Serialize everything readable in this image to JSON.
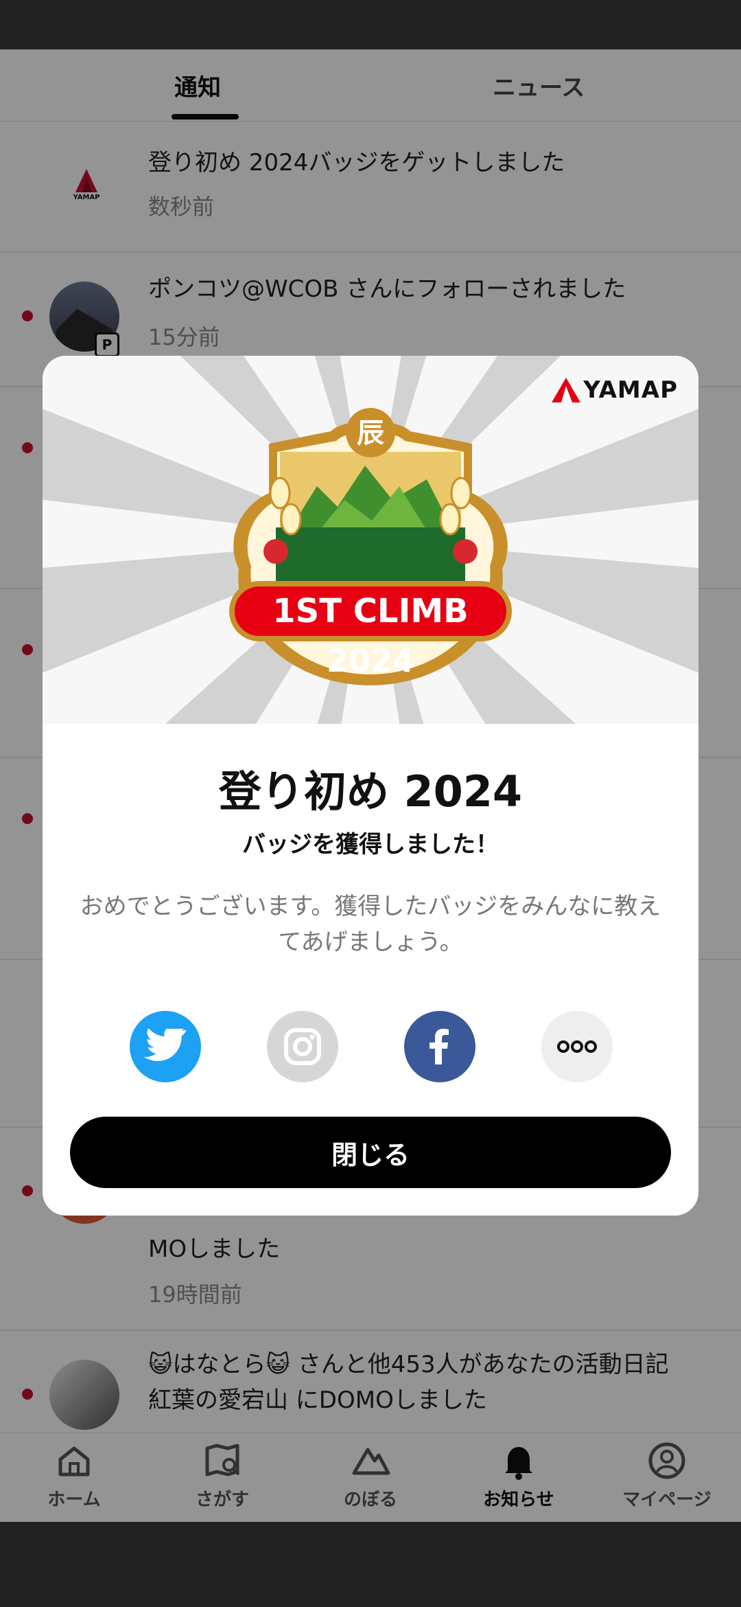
{
  "tabs": {
    "notifications": "通知",
    "news": "ニュース"
  },
  "notifications": [
    {
      "text": "登り初め 2024バッジをゲットしました",
      "time": "数秒前",
      "logo_text": "YAMAP"
    },
    {
      "text": "ポンコツ@WCOB さんにフォローされました",
      "time": "15分前",
      "badge": "P"
    },
    {
      "text_line2": "MOしました",
      "time": "19時間前"
    },
    {
      "text_line1": "😺はなとら😺 さんと他453人があなたの活動日記",
      "text_line2": "紅葉の愛宕山 にDOMOしました"
    }
  ],
  "modal": {
    "brand": "YAMAP",
    "badge_zodiac": "辰",
    "badge_title": "1ST CLIMB",
    "badge_year": "2024",
    "title": "登り初め 2024",
    "subtitle": "バッジを獲得しました！",
    "message": "おめでとうございます。獲得したバッジをみんなに教えてあげましょう。",
    "share": [
      "twitter-icon",
      "instagram-icon",
      "facebook-icon",
      "more-icon"
    ],
    "close_label": "閉じる"
  },
  "navbar": {
    "home": "ホーム",
    "search": "さがす",
    "climb": "のぼる",
    "notifications": "お知らせ",
    "mypage": "マイページ"
  },
  "colors": {
    "accent_red": "#c8102e",
    "twitter": "#1da1f2",
    "facebook": "#3b5998",
    "badge_gold": "#c98f2b"
  }
}
